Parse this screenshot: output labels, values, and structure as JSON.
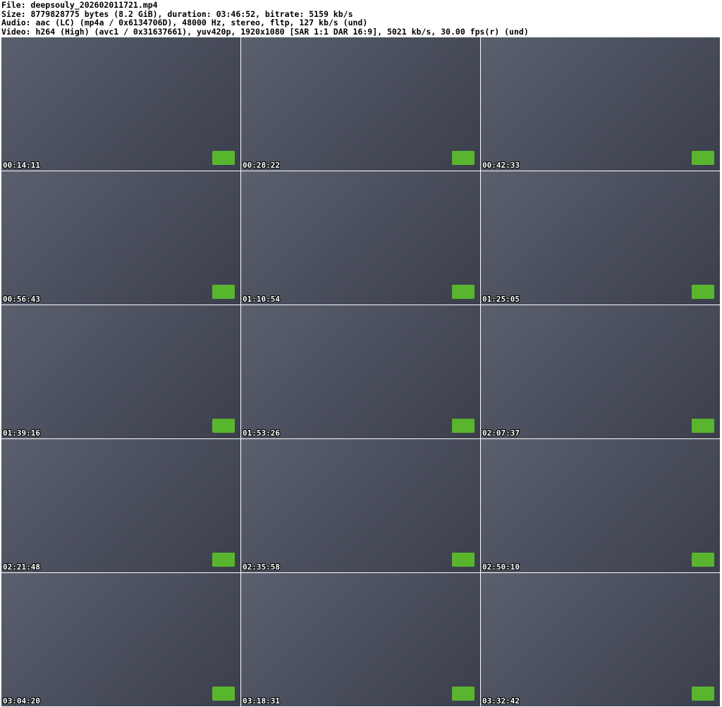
{
  "header": {
    "file": "File: deepsouly_202602011721.mp4",
    "size": "Size: 8779828775 bytes (8.2 GiB), duration: 03:46:52, bitrate: 5159 kb/s",
    "audio": "Audio: aac (LC) (mp4a / 0x6134706D), 48000 Hz, stereo, fltp, 127 kb/s (und)",
    "video": "Video: h264 (High) (avc1 / 0x31637661), yuv420p, 1920x1080 [SAR 1:1 DAR 16:9], 5021 kb/s, 30.00 fps(r) (und)"
  },
  "thumbnails": [
    {
      "time": "00:14:11"
    },
    {
      "time": "00:28:22"
    },
    {
      "time": "00:42:33"
    },
    {
      "time": "00:56:43"
    },
    {
      "time": "01:10:54"
    },
    {
      "time": "01:25:05"
    },
    {
      "time": "01:39:16"
    },
    {
      "time": "01:53:26"
    },
    {
      "time": "02:07:37"
    },
    {
      "time": "02:21:48"
    },
    {
      "time": "02:35:58"
    },
    {
      "time": "02:50:10"
    },
    {
      "time": "03:04:20"
    },
    {
      "time": "03:18:31"
    },
    {
      "time": "03:32:42"
    }
  ],
  "colors": {
    "badge": "#5ab52e"
  }
}
